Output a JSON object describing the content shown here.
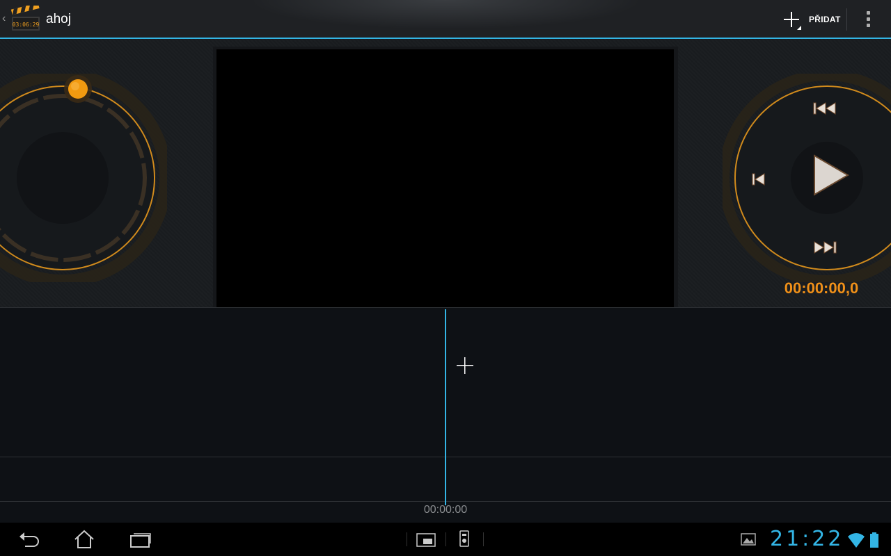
{
  "actionbar": {
    "title": "ahoj",
    "app_icon": "clapperboard-icon",
    "app_icon_text": "03:06:29",
    "add_label": "PŘIDAT",
    "overflow_icon": "overflow-menu-icon"
  },
  "player": {
    "timecode": "00:00:00,0",
    "controls": [
      "skip-to-start-icon",
      "step-back-icon",
      "play-icon",
      "skip-to-end-icon"
    ]
  },
  "timeline": {
    "position_label": "00:00:00",
    "add_icon": "plus-icon"
  },
  "navbar": {
    "clock": "21:22",
    "icons": [
      "back-icon",
      "home-icon",
      "recent-apps-icon",
      "screen-icon",
      "usb-debug-icon",
      "gallery-notification-icon",
      "wifi-icon",
      "battery-icon"
    ]
  },
  "colors": {
    "accent": "#33b5e5",
    "orange": "#f09018",
    "background": "#0d1014"
  }
}
